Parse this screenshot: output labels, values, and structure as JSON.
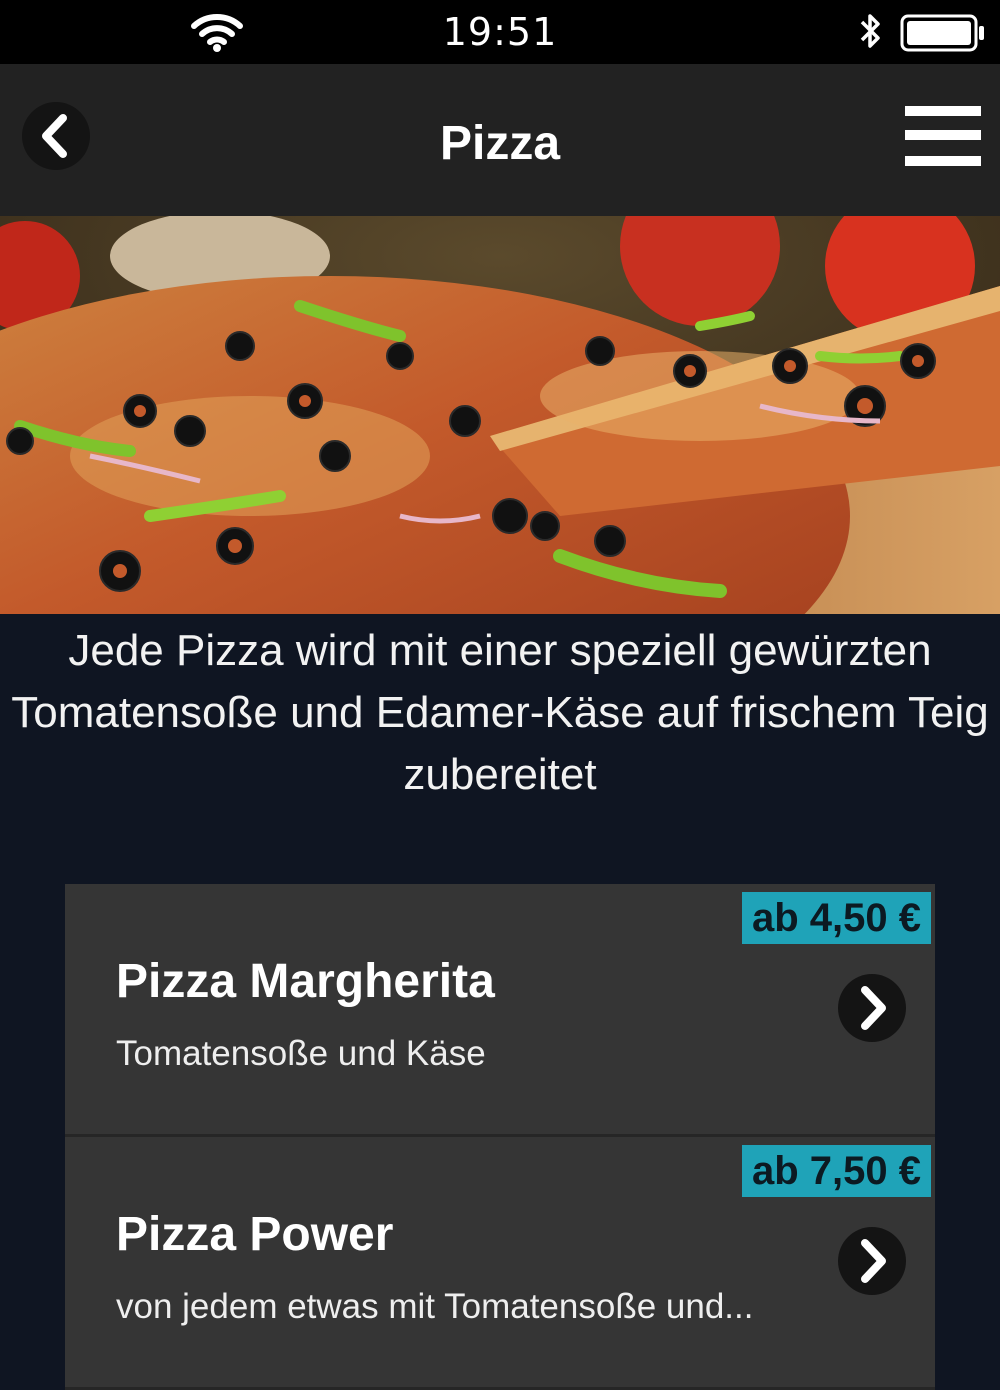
{
  "status_bar": {
    "time": "19:51",
    "wifi_icon": "wifi-icon",
    "bluetooth_icon": "bluetooth-icon",
    "battery_icon": "battery-icon"
  },
  "nav": {
    "title": "Pizza",
    "back_icon": "chevron-left-icon",
    "menu_icon": "hamburger-menu-icon"
  },
  "hero": {
    "image": "pizza-photo"
  },
  "intro": {
    "text": "Jede Pizza wird mit einer speziell gewürzten Tomatensoße und Edamer-Käse auf frischem Teig zubereitet"
  },
  "items": [
    {
      "price": "ab 4,50 €",
      "title": "Pizza Margherita",
      "description": "Tomatensoße und Käse"
    },
    {
      "price": "ab 7,50 €",
      "title": "Pizza Power",
      "description": "von jedem etwas mit Tomatensoße und..."
    }
  ],
  "colors": {
    "background": "#0f1522",
    "nav_bar": "#222222",
    "card": "#353535",
    "price_badge": "#1fa3b8"
  }
}
